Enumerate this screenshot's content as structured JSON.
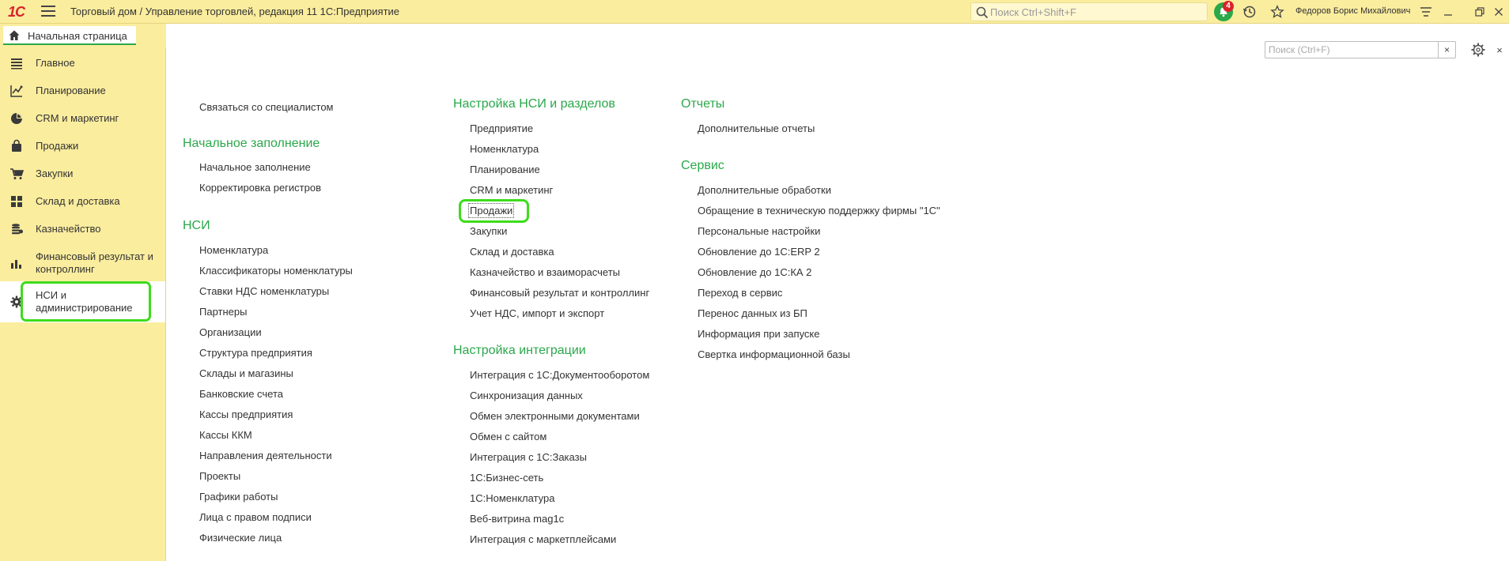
{
  "titlebar": {
    "logo": "1С",
    "title": "Торговый дом / Управление торговлей, редакция 11 1С:Предприятие",
    "search_placeholder": "Поиск Ctrl+Shift+F",
    "notification_count": "4",
    "user": "Федоров Борис Михайлович"
  },
  "tab": {
    "home_label": "Начальная страница"
  },
  "sidebar": {
    "items": [
      {
        "label": "Главное",
        "icon": "list-icon"
      },
      {
        "label": "Планирование",
        "icon": "chart-icon"
      },
      {
        "label": "CRM и маркетинг",
        "icon": "pie-icon"
      },
      {
        "label": "Продажи",
        "icon": "bag-icon"
      },
      {
        "label": "Закупки",
        "icon": "cart-icon"
      },
      {
        "label": "Склад и доставка",
        "icon": "grid-icon"
      },
      {
        "label": "Казначейство",
        "icon": "coins-icon"
      },
      {
        "label": "Финансовый результат и контроллинг",
        "icon": "bars-icon"
      },
      {
        "label": "НСИ и администрирование",
        "icon": "gear-icon"
      }
    ]
  },
  "form": {
    "search_placeholder": "Поиск (Ctrl+F)",
    "clear": "×",
    "close": "×"
  },
  "columns": {
    "col1": {
      "top_link": "Связаться со специалистом",
      "sections": [
        {
          "title": "Начальное заполнение",
          "links": [
            "Начальное заполнение",
            "Корректировка регистров"
          ]
        },
        {
          "title": "НСИ",
          "links": [
            "Номенклатура",
            "Классификаторы номенклатуры",
            "Ставки НДС номенклатуры",
            "Партнеры",
            "Организации",
            "Структура предприятия",
            "Склады и магазины",
            "Банковские счета",
            "Кассы предприятия",
            "Кассы ККМ",
            "Направления деятельности",
            "Проекты",
            "Графики работы",
            "Лица с правом подписи",
            "Физические лица"
          ]
        }
      ]
    },
    "col2": {
      "sections": [
        {
          "title": "Настройка НСИ и разделов",
          "links": [
            "Предприятие",
            "Номенклатура",
            "Планирование",
            "CRM и маркетинг",
            "Продажи",
            "Закупки",
            "Склад и доставка",
            "Казначейство и взаиморасчеты",
            "Финансовый результат и контроллинг",
            "Учет НДС, импорт и экспорт"
          ]
        },
        {
          "title": "Настройка интеграции",
          "links": [
            "Интеграция с 1С:Документооборотом",
            "Синхронизация данных",
            "Обмен электронными документами",
            "Обмен с сайтом",
            "Интеграция с 1С:Заказы",
            "1С:Бизнес-сеть",
            "1С:Номенклатура",
            "Веб-витрина mag1c",
            "Интеграция с маркетплейсами"
          ]
        }
      ]
    },
    "col3": {
      "sections": [
        {
          "title": "Отчеты",
          "links": [
            "Дополнительные отчеты"
          ]
        },
        {
          "title": "Сервис",
          "links": [
            "Дополнительные обработки",
            "Обращение в техническую поддержку фирмы \"1С\"",
            "Персональные настройки",
            "Обновление до 1С:ERP 2",
            "Обновление до 1С:КА 2",
            "Переход в сервис",
            "Перенос данных из БП",
            "Информация при запуске",
            "Свертка информационной базы"
          ]
        }
      ]
    }
  },
  "colors": {
    "accent_green": "#2aa84a",
    "highlight_green": "#3ddc1c",
    "panel_yellow": "#fbed9e"
  }
}
